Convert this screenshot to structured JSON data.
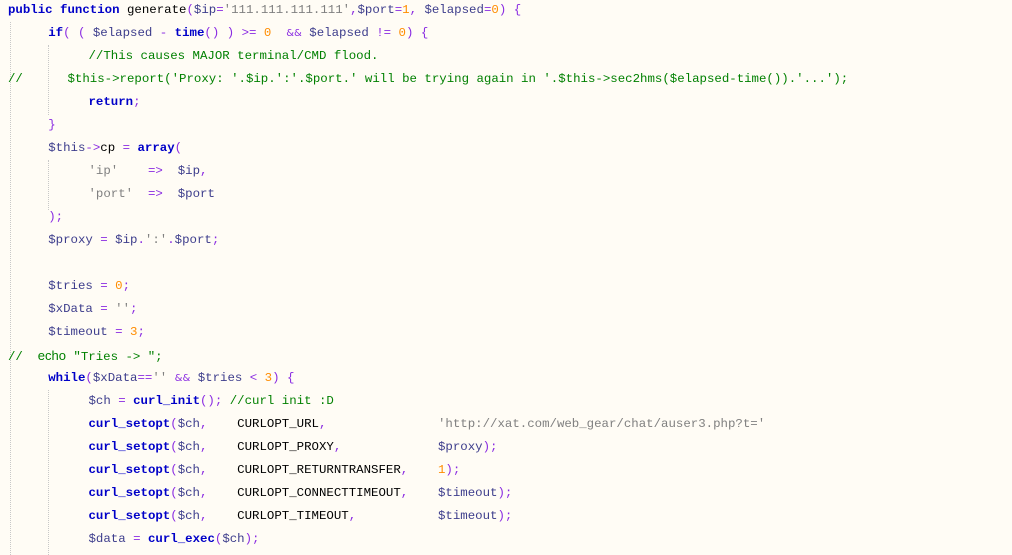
{
  "editor": {
    "language": "php",
    "colors": {
      "background": "#FFFCF5",
      "keyword": "#0000C8",
      "variable": "#3D3D8C",
      "operator": "#8A2BE2",
      "number": "#FF8C00",
      "string": "#808080",
      "comment": "#008000"
    },
    "lines": [
      {
        "indent": 0,
        "tokens": [
          [
            "kw",
            "public function"
          ],
          [
            "plain",
            " generate"
          ],
          [
            "op",
            "("
          ],
          [
            "var",
            "$ip"
          ],
          [
            "op",
            "="
          ],
          [
            "str",
            "'111.111.111.111'"
          ],
          [
            "op",
            ","
          ],
          [
            "var",
            "$port"
          ],
          [
            "op",
            "="
          ],
          [
            "num",
            "1"
          ],
          [
            "op",
            ","
          ],
          [
            "plain",
            " "
          ],
          [
            "var",
            "$elapsed"
          ],
          [
            "op",
            "="
          ],
          [
            "num",
            "0"
          ],
          [
            "op",
            ")"
          ],
          [
            "plain",
            " "
          ],
          [
            "op",
            "{"
          ]
        ]
      },
      {
        "indent": 1,
        "tokens": [
          [
            "kw",
            "if"
          ],
          [
            "op",
            "("
          ],
          [
            "plain",
            " "
          ],
          [
            "op",
            "("
          ],
          [
            "plain",
            " "
          ],
          [
            "var",
            "$elapsed"
          ],
          [
            "plain",
            " "
          ],
          [
            "op",
            "-"
          ],
          [
            "plain",
            " "
          ],
          [
            "fn",
            "time"
          ],
          [
            "op",
            "()"
          ],
          [
            "plain",
            " "
          ],
          [
            "op",
            ")"
          ],
          [
            "plain",
            " "
          ],
          [
            "op",
            ">="
          ],
          [
            "plain",
            " "
          ],
          [
            "num",
            "0"
          ],
          [
            "plain",
            "  "
          ],
          [
            "amp",
            "&&"
          ],
          [
            "plain",
            " "
          ],
          [
            "var",
            "$elapsed"
          ],
          [
            "plain",
            " "
          ],
          [
            "op",
            "!="
          ],
          [
            "plain",
            " "
          ],
          [
            "num",
            "0"
          ],
          [
            "op",
            ")"
          ],
          [
            "plain",
            " "
          ],
          [
            "op",
            "{"
          ]
        ]
      },
      {
        "indent": 2,
        "tokens": [
          [
            "cm",
            "//This causes MAJOR terminal/CMD flood."
          ]
        ]
      },
      {
        "indent": 0,
        "tokens": [
          [
            "cm",
            "//      $this->report('Proxy: '.$ip.':'.$port.' will be trying again in '.$this->sec2hms($elapsed-time()).'...');"
          ]
        ]
      },
      {
        "indent": 2,
        "tokens": [
          [
            "kw",
            "return"
          ],
          [
            "op",
            ";"
          ]
        ]
      },
      {
        "indent": 1,
        "tokens": [
          [
            "op",
            "}"
          ]
        ]
      },
      {
        "indent": 1,
        "tokens": [
          [
            "var",
            "$this"
          ],
          [
            "op",
            "->"
          ],
          [
            "plain",
            "cp"
          ],
          [
            "plain",
            " "
          ],
          [
            "op",
            "="
          ],
          [
            "plain",
            " "
          ],
          [
            "kw",
            "array"
          ],
          [
            "op",
            "("
          ]
        ]
      },
      {
        "indent": 2,
        "tokens": [
          [
            "str",
            "'ip'"
          ],
          [
            "plain",
            "    "
          ],
          [
            "op",
            "=>"
          ],
          [
            "plain",
            "  "
          ],
          [
            "var",
            "$ip"
          ],
          [
            "op",
            ","
          ]
        ]
      },
      {
        "indent": 2,
        "tokens": [
          [
            "str",
            "'port'"
          ],
          [
            "plain",
            "  "
          ],
          [
            "op",
            "=>"
          ],
          [
            "plain",
            "  "
          ],
          [
            "var",
            "$port"
          ]
        ]
      },
      {
        "indent": 1,
        "tokens": [
          [
            "op",
            ");"
          ]
        ]
      },
      {
        "indent": 1,
        "tokens": [
          [
            "var",
            "$proxy"
          ],
          [
            "plain",
            " "
          ],
          [
            "op",
            "="
          ],
          [
            "plain",
            " "
          ],
          [
            "var",
            "$ip"
          ],
          [
            "op",
            "."
          ],
          [
            "str",
            "':'"
          ],
          [
            "op",
            "."
          ],
          [
            "var",
            "$port"
          ],
          [
            "op",
            ";"
          ]
        ]
      },
      {
        "indent": 1,
        "tokens": []
      },
      {
        "indent": 1,
        "tokens": [
          [
            "var",
            "$tries"
          ],
          [
            "plain",
            " "
          ],
          [
            "op",
            "="
          ],
          [
            "plain",
            " "
          ],
          [
            "num",
            "0"
          ],
          [
            "op",
            ";"
          ]
        ]
      },
      {
        "indent": 1,
        "tokens": [
          [
            "var",
            "$xData"
          ],
          [
            "plain",
            " "
          ],
          [
            "op",
            "="
          ],
          [
            "plain",
            " "
          ],
          [
            "str",
            "''"
          ],
          [
            "op",
            ";"
          ]
        ]
      },
      {
        "indent": 1,
        "tokens": [
          [
            "var",
            "$timeout"
          ],
          [
            "plain",
            " "
          ],
          [
            "op",
            "="
          ],
          [
            "plain",
            " "
          ],
          [
            "num",
            "3"
          ],
          [
            "op",
            ";"
          ]
        ]
      },
      {
        "indent": 0,
        "tokens": [
          [
            "cm",
            "//  "
          ],
          [
            "cm-sans",
            "echo"
          ],
          [
            "cm",
            " \"Tries -> \";"
          ]
        ]
      },
      {
        "indent": 1,
        "tokens": [
          [
            "kw",
            "while"
          ],
          [
            "op",
            "("
          ],
          [
            "var",
            "$xData"
          ],
          [
            "op",
            "=="
          ],
          [
            "str",
            "''"
          ],
          [
            "plain",
            " "
          ],
          [
            "amp",
            "&&"
          ],
          [
            "plain",
            " "
          ],
          [
            "var",
            "$tries"
          ],
          [
            "plain",
            " "
          ],
          [
            "op",
            "<"
          ],
          [
            "plain",
            " "
          ],
          [
            "num",
            "3"
          ],
          [
            "op",
            ")"
          ],
          [
            "plain",
            " "
          ],
          [
            "op",
            "{"
          ]
        ]
      },
      {
        "indent": 2,
        "tokens": [
          [
            "var",
            "$ch"
          ],
          [
            "plain",
            " "
          ],
          [
            "op",
            "="
          ],
          [
            "plain",
            " "
          ],
          [
            "fn",
            "curl_init"
          ],
          [
            "op",
            "();"
          ],
          [
            "plain",
            " "
          ],
          [
            "cm",
            "//curl init :D"
          ]
        ]
      },
      {
        "indent": 2,
        "tokens": [
          [
            "fn",
            "curl_setopt"
          ],
          [
            "op",
            "("
          ],
          [
            "var",
            "$ch"
          ],
          [
            "op",
            ","
          ],
          [
            "plain",
            "    CURLOPT_URL"
          ],
          [
            "op",
            ","
          ],
          [
            "plain",
            "               "
          ],
          [
            "str",
            "'http://xat.com/web_gear/chat/auser3.php?t='"
          ]
        ]
      },
      {
        "indent": 2,
        "tokens": [
          [
            "fn",
            "curl_setopt"
          ],
          [
            "op",
            "("
          ],
          [
            "var",
            "$ch"
          ],
          [
            "op",
            ","
          ],
          [
            "plain",
            "    CURLOPT_PROXY"
          ],
          [
            "op",
            ","
          ],
          [
            "plain",
            "             "
          ],
          [
            "var",
            "$proxy"
          ],
          [
            "op",
            ");"
          ]
        ]
      },
      {
        "indent": 2,
        "tokens": [
          [
            "fn",
            "curl_setopt"
          ],
          [
            "op",
            "("
          ],
          [
            "var",
            "$ch"
          ],
          [
            "op",
            ","
          ],
          [
            "plain",
            "    CURLOPT_RETURNTRANSFER"
          ],
          [
            "op",
            ","
          ],
          [
            "plain",
            "    "
          ],
          [
            "num",
            "1"
          ],
          [
            "op",
            ");"
          ]
        ]
      },
      {
        "indent": 2,
        "tokens": [
          [
            "fn",
            "curl_setopt"
          ],
          [
            "op",
            "("
          ],
          [
            "var",
            "$ch"
          ],
          [
            "op",
            ","
          ],
          [
            "plain",
            "    CURLOPT_CONNECTTIMEOUT"
          ],
          [
            "op",
            ","
          ],
          [
            "plain",
            "    "
          ],
          [
            "var",
            "$timeout"
          ],
          [
            "op",
            ");"
          ]
        ]
      },
      {
        "indent": 2,
        "tokens": [
          [
            "fn",
            "curl_setopt"
          ],
          [
            "op",
            "("
          ],
          [
            "var",
            "$ch"
          ],
          [
            "op",
            ","
          ],
          [
            "plain",
            "    CURLOPT_TIMEOUT"
          ],
          [
            "op",
            ","
          ],
          [
            "plain",
            "           "
          ],
          [
            "var",
            "$timeout"
          ],
          [
            "op",
            ");"
          ]
        ]
      },
      {
        "indent": 2,
        "tokens": [
          [
            "var",
            "$data"
          ],
          [
            "plain",
            " "
          ],
          [
            "op",
            "="
          ],
          [
            "plain",
            " "
          ],
          [
            "fn",
            "curl_exec"
          ],
          [
            "op",
            "("
          ],
          [
            "var",
            "$ch"
          ],
          [
            "op",
            ");"
          ]
        ]
      }
    ]
  }
}
